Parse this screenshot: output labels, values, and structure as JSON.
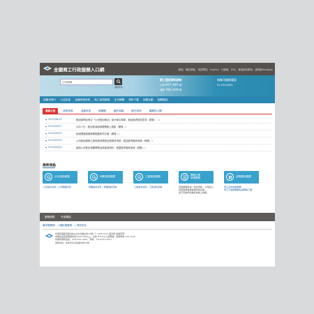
{
  "header": {
    "site_title": "全國商工行政服務入口網",
    "top_links": [
      "首頁",
      "網站導覽",
      "常見問答",
      "English",
      "行動版",
      "RSS",
      "經濟部商業司",
      "經濟部Facebook"
    ]
  },
  "search": {
    "placeholder": "",
    "value": "公司搜尋",
    "advanced": "進階搜尋"
  },
  "stats": {
    "title": "商工登記資料統計",
    "companies_label": "公司",
    "companies_value": "607,985",
    "companies_unit": "家",
    "firms_label": "商號",
    "firms_value": "786,009",
    "firms_unit": "家"
  },
  "hotline": {
    "title": "商業司服務電話",
    "number": "02-23212851"
  },
  "nav": {
    "items": [
      "商業司簡介",
      "公告訊息",
      "全國申辦系統",
      "商工查詢服務",
      "法令解釋",
      "資料下載",
      "商業互動",
      "相關連結"
    ]
  },
  "news": {
    "tabs": [
      "最新公告",
      "政策消息",
      "活動訊息",
      "新聞稿",
      "國外商展",
      "觀光資訊",
      "機關性公開"
    ],
    "active_tab": 0,
    "items": [
      {
        "date": "2015/06/19",
        "title": "經濟部預告修正「公司登記辦法」部分條文草案，歡迎各界提供意見（閱覽：…）"
      },
      {
        "date": "2015/05/27",
        "title": "5月27日，配合經濟部辦理業務上更新（閱覽…）"
      },
      {
        "date": "2015/05/20",
        "title": "拒絕理健康服務業推動研究計畫（閱覽…）"
      },
      {
        "date": "2015/05/19",
        "title": "公司登記服務之調查與商業登記聲明書申請，歡迎各界廠商參與（閱覽…）"
      },
      {
        "date": "2015/04/24",
        "title": "函請公司登記相關業務及原宣導資料，登載各界廠商參考（閱覽…）"
      }
    ]
  },
  "business": {
    "heading": "業務焦點",
    "cards": [
      {
        "label": "公司查詢服務",
        "desc": [
          "公司基本資料｜公司等級判定"
        ]
      },
      {
        "label": "商業查詢服務",
        "desc": [
          "商業基本資料｜商業登記查詢"
        ]
      },
      {
        "label": "工廠查詢服務",
        "desc": [
          "工廠基本資料｜工廠資料查詢"
        ]
      },
      {
        "label": "開辦企業",
        "label2": "申請服務",
        "desc": [
          "透過網路取得一站式申請：公司設立、",
          "變更與解散等各類申辦功能，",
          "並可查詢申辦進度與線上繳費。"
        ]
      },
      {
        "label": "多樣應用服務",
        "desc": [
          "商工資料開放服務",
          "商工行政服務網站瀏覽與下載"
        ]
      }
    ]
  },
  "bottom_nav": [
    "服務總覽",
    "外部連結"
  ],
  "footer": {
    "links": [
      "著作權聲明",
      "隱私權聲明",
      "資訊安全"
    ],
    "lines": [
      "中華民國經濟部(地址:台北市福州街15號) © 2005-2011 經濟部 版權所有",
      "本網站最佳瀏覽解析度1024*768以上，支援 IE 8.0以上瀏覽器，服務專線 412-1166",
      "商業司服務電話：(02)2321-2851，傳真：(02)2351-8101",
      "通訊地址：臺北市中正區福州街15號"
    ]
  },
  "colors": {
    "header_bg": "#55514e",
    "nav_bg": "#2c86b2",
    "accent_red": "#dd3333",
    "card_bg": "#38a2cd",
    "page_bg": "#d9dadb"
  }
}
